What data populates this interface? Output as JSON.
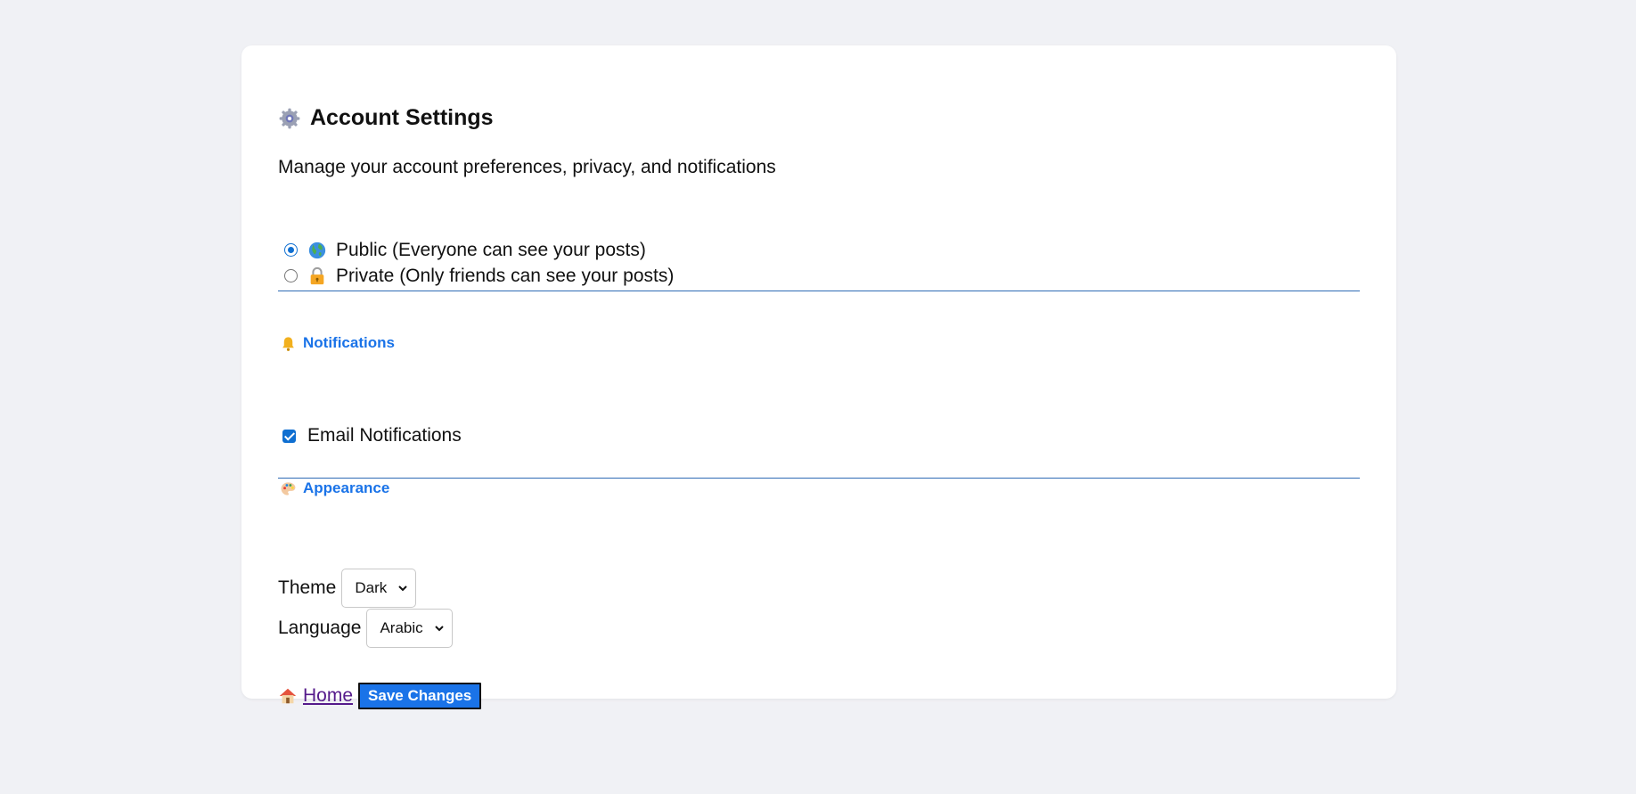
{
  "header": {
    "icon": "gear-icon",
    "title": "Account Settings",
    "subtitle": "Manage your account preferences, privacy, and notifications"
  },
  "privacy": {
    "options": [
      {
        "icon": "globe-icon",
        "label": "Public (Everyone can see your posts)",
        "checked": true
      },
      {
        "icon": "lock-icon",
        "label": "Private (Only friends can see your posts)",
        "checked": false
      }
    ]
  },
  "notifications": {
    "icon": "bell-icon",
    "heading": "Notifications",
    "email_label": "Email Notifications",
    "email_checked": true
  },
  "appearance": {
    "icon": "palette-icon",
    "heading": "Appearance",
    "theme_label": "Theme",
    "theme_value": "Dark",
    "language_label": "Language",
    "language_value": "Arabic"
  },
  "actions": {
    "home_icon": "house-icon",
    "home_label": "Home",
    "save_label": "Save Changes"
  },
  "colors": {
    "page_bg": "#f0f1f5",
    "accent": "#1a73e8",
    "link": "#551a8b",
    "divider": "#2f6bb5"
  }
}
